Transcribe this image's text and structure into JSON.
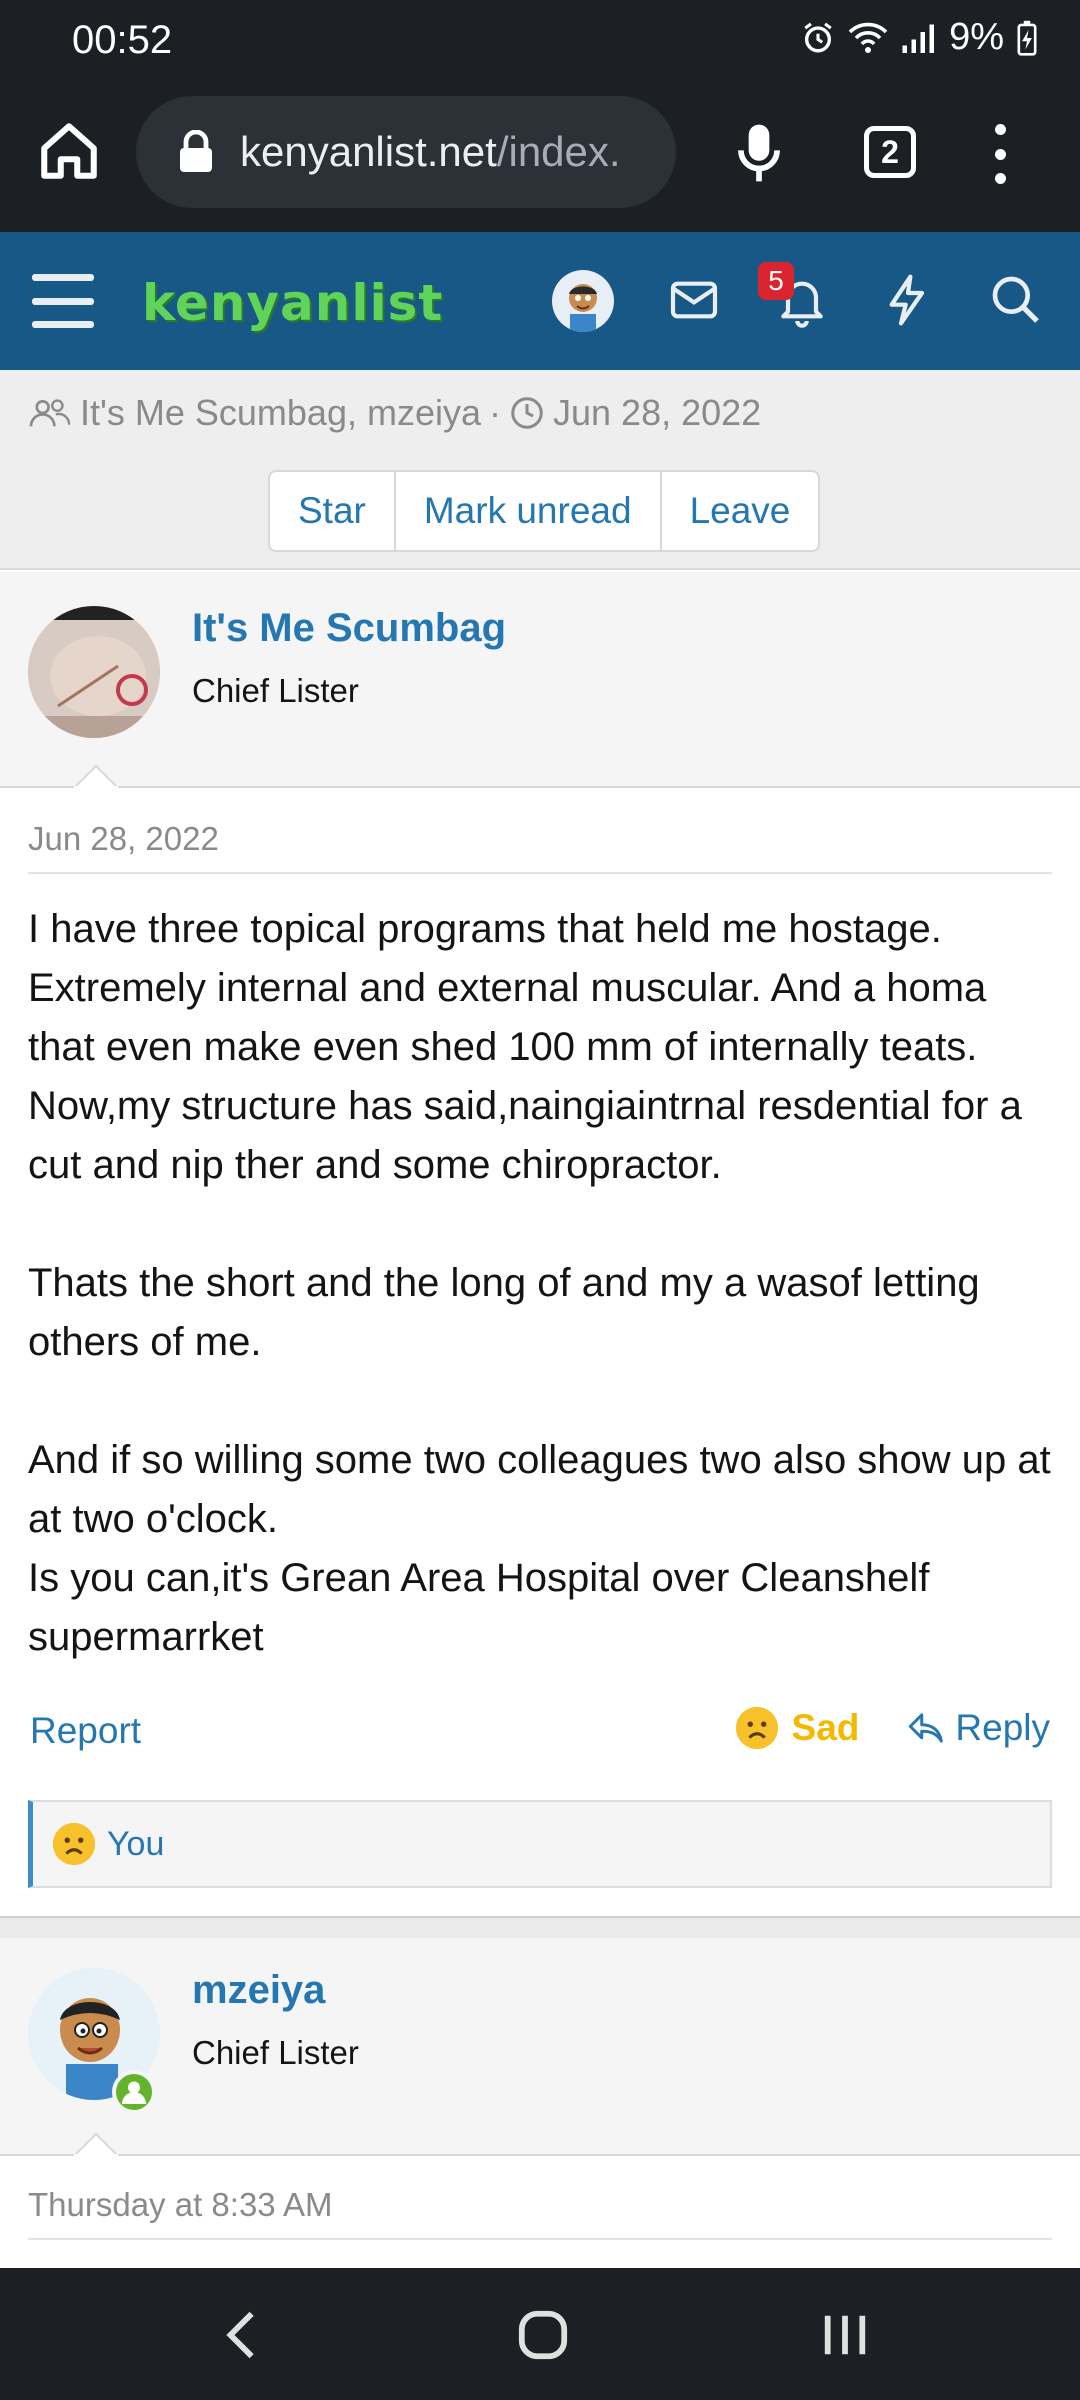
{
  "status_bar": {
    "time": "00:52",
    "battery": "9%",
    "icons": [
      "alarm-icon",
      "wifi-icon",
      "signal-icon",
      "battery-charging-icon"
    ]
  },
  "browser": {
    "url_host": "kenyanlist.net",
    "url_path": "/index.",
    "tab_count": "2"
  },
  "site": {
    "logo_text": "kenyanlist",
    "notification_count": "5",
    "brand_color": "#185886",
    "link_color": "#2577b1"
  },
  "thread": {
    "participants": "It's Me Scumbag, mzeiya",
    "separator": "·",
    "date": "Jun 28, 2022",
    "buttons": {
      "star": "Star",
      "mark_unread": "Mark unread",
      "leave": "Leave"
    }
  },
  "posts": [
    {
      "username": "It's Me Scumbag",
      "user_title": "Chief Lister",
      "date": "Jun 28, 2022",
      "paragraphs": [
        "I have three topical programs that held me hostage. Extremely internal and external muscular. And a homa that even make even shed 100 mm of internally teats. Now,my structure has said,naingiaintrnal resdential for a cut and nip ther and some chiropractor.",
        "Thats the short and the long of and my a wasof letting others of me.",
        "And if so willing some two colleagues two also show up at at two o'clock.",
        "Is you can,it's Grean Area Hospital over Cleanshelf supermarrket"
      ],
      "report_label": "Report",
      "reaction_label": "Sad",
      "reply_label": "Reply",
      "reacted_by": "You"
    },
    {
      "username": "mzeiya",
      "user_title": "Chief Lister",
      "date": "Thursday at 8:33 AM"
    }
  ]
}
